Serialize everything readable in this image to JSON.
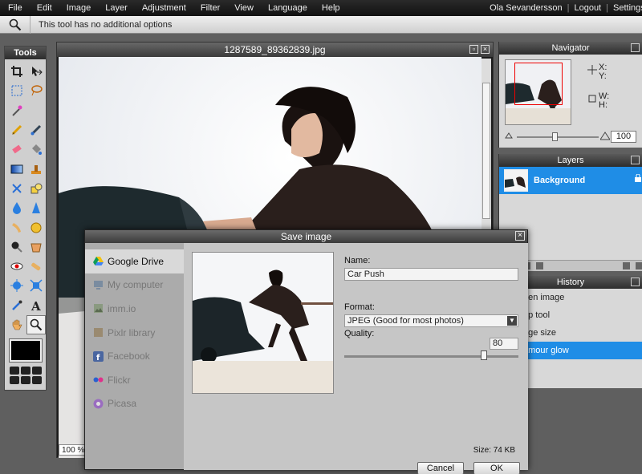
{
  "menu": [
    "File",
    "Edit",
    "Image",
    "Layer",
    "Adjustment",
    "Filter",
    "View",
    "Language",
    "Help"
  ],
  "user": {
    "name": "Ola Sevandersson",
    "logout": "Logout",
    "settings": "Settings"
  },
  "options_bar": {
    "text": "This tool has no additional options"
  },
  "tools": {
    "title": "Tools"
  },
  "document": {
    "title": "1287589_89362839.jpg",
    "zoom": "100 %"
  },
  "navigator": {
    "title": "Navigator",
    "x_label": "X:",
    "y_label": "Y:",
    "w_label": "W:",
    "h_label": "H:",
    "zoom": "100"
  },
  "layers": {
    "title": "Layers",
    "items": [
      {
        "name": "Background"
      }
    ]
  },
  "history": {
    "title": "History",
    "items": [
      "Open image",
      "Crop tool",
      "Image size",
      "Glamour glow"
    ],
    "visible_items": [
      "pen image",
      "op tool",
      "age size",
      "amour glow"
    ]
  },
  "dialog": {
    "title": "Save image",
    "services": [
      "Google Drive",
      "My computer",
      "imm.io",
      "Pixlr library",
      "Facebook",
      "Flickr",
      "Picasa"
    ],
    "name_label": "Name:",
    "name_value": "Car Push",
    "format_label": "Format:",
    "format_value": "JPEG (Good for most photos)",
    "quality_label": "Quality:",
    "quality_value": "80",
    "size_text": "Size: 74 KB",
    "cancel": "Cancel",
    "ok": "OK"
  },
  "colors": {
    "accent": "#1f8de6",
    "menubar": "#111111",
    "panel": "#d8d8d8"
  }
}
